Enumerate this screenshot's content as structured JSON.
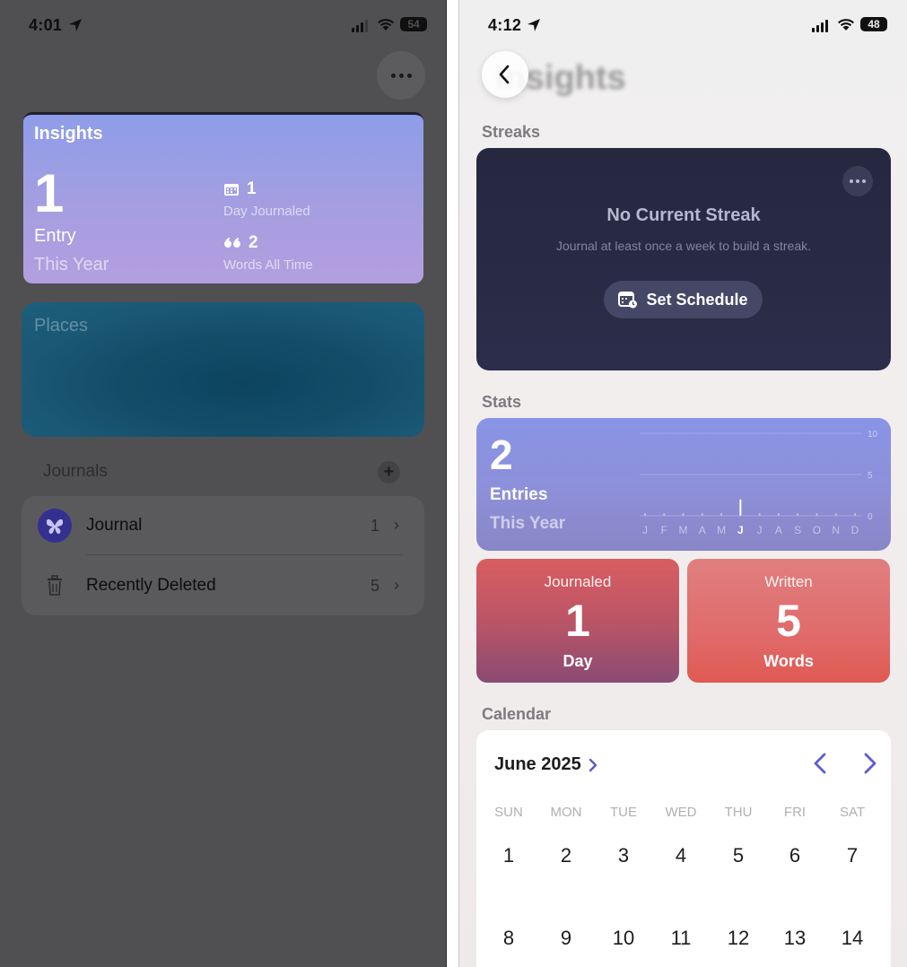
{
  "left_screen": {
    "status": {
      "time": "4:01",
      "battery": "54"
    },
    "insights": {
      "title": "Insights",
      "entries_count": "1",
      "entries_label": "Entry",
      "period": "This Year",
      "days_count": "1",
      "days_label": "Day Journaled",
      "words_count": "2",
      "words_label": "Words All Time"
    },
    "places": {
      "title": "Places"
    },
    "journals": {
      "heading": "Journals",
      "items": [
        {
          "label": "Journal",
          "count": "1"
        },
        {
          "label": "Recently Deleted",
          "count": "5"
        }
      ]
    }
  },
  "right_screen": {
    "status": {
      "time": "4:12",
      "battery": "48"
    },
    "nav_title": "Insights",
    "streaks": {
      "section": "Streaks",
      "title": "No Current Streak",
      "subtitle": "Journal at least once a week to build a streak.",
      "button": "Set Schedule"
    },
    "stats": {
      "section": "Stats",
      "entries_count": "2",
      "entries_label": "Entries",
      "period": "This Year",
      "journaled": {
        "top": "Journaled",
        "value": "1",
        "unit": "Day"
      },
      "written": {
        "top": "Written",
        "value": "5",
        "unit": "Words"
      }
    },
    "calendar": {
      "section": "Calendar",
      "month": "June 2025",
      "weekdays": [
        "SUN",
        "MON",
        "TUE",
        "WED",
        "THU",
        "FRI",
        "SAT"
      ],
      "week1": [
        "1",
        "2",
        "3",
        "4",
        "5",
        "6",
        "7"
      ],
      "week2": [
        "8",
        "9",
        "10",
        "11",
        "12",
        "13",
        "14"
      ]
    }
  },
  "chart_data": {
    "type": "bar",
    "categories": [
      "J",
      "F",
      "M",
      "A",
      "M",
      "J",
      "J",
      "A",
      "S",
      "O",
      "N",
      "D"
    ],
    "values": [
      0,
      0,
      0,
      0,
      0,
      2,
      0,
      0,
      0,
      0,
      0,
      0
    ],
    "y_ticks": [
      "10",
      "5",
      "0"
    ],
    "ylim": [
      0,
      10
    ],
    "highlight_index": 5
  },
  "colors": {
    "left_bg": "#505053",
    "insights_gradient_top": "#8e9de9",
    "streak_card": "#262840",
    "stats_card": "#8894e6",
    "journaled_tile": "#d95d61",
    "written_tile": "#e06b6b",
    "calendar_accent": "#5b5bd6"
  },
  "icons": [
    "location-arrow-icon",
    "signal-icon",
    "wifi-icon",
    "battery-icon",
    "more-icon",
    "calendar-icon",
    "quote-icon",
    "butterfly-icon",
    "trash-icon",
    "chevron-right-icon",
    "plus-icon",
    "back-chevron-icon",
    "calendar-schedule-icon",
    "chevron-left-icon"
  ]
}
